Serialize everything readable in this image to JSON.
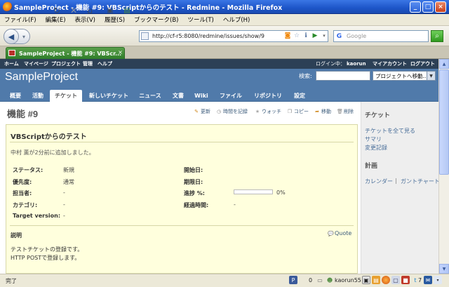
{
  "window": {
    "title": "SampleProject - 機能 #9: VBScriptからのテスト - Redmine - Mozilla Firefox"
  },
  "menubar": [
    "ファイル(F)",
    "編集(E)",
    "表示(V)",
    "履歴(S)",
    "ブックマーク(B)",
    "ツール(T)",
    "ヘルプ(H)"
  ],
  "address": {
    "url": "http://cf-r5:8080/redmine/issues/show/9"
  },
  "search": {
    "placeholder": "Google",
    "engine_icon": "G"
  },
  "tab": {
    "label": "SampleProject - 機能 #9: VBScr..."
  },
  "redmine": {
    "top_menu": [
      "ホーム",
      "マイページ",
      "プロジェクト",
      "管理",
      "ヘルプ"
    ],
    "login_prefix": "ログイン中：",
    "login_user": "kaorun",
    "account_links": [
      "マイアカウント",
      "ログアウト"
    ],
    "project_title": "SampleProject",
    "search_label": "検索:",
    "jump_select": "プロジェクトへ移動...",
    "main_tabs": [
      "概要",
      "活動",
      "チケット",
      "新しいチケット",
      "ニュース",
      "文書",
      "Wiki",
      "ファイル",
      "リポジトリ",
      "設定"
    ],
    "active_tab_index": 2
  },
  "issue": {
    "title": "機能 #9",
    "context_actions": [
      "更新",
      "時間を記録",
      "ウォッチ",
      "コピー",
      "移動",
      "削除"
    ],
    "subject": "VBScriptからのテスト",
    "author_line": "中村 薫が2分前に追加しました。",
    "attributes_left": [
      {
        "label": "ステータス:",
        "value": "新規"
      },
      {
        "label": "優先度:",
        "value": "通常"
      },
      {
        "label": "担当者:",
        "value": "-"
      },
      {
        "label": "カテゴリ:",
        "value": "-"
      },
      {
        "label": "Target version:",
        "value": "-"
      }
    ],
    "attributes_right": [
      {
        "label": "開始日:",
        "value": ""
      },
      {
        "label": "期限日:",
        "value": ""
      },
      {
        "label": "進捗 %:",
        "value": "0%"
      },
      {
        "label": "経過時間:",
        "value": "-"
      }
    ],
    "progress": 0,
    "description_label": "説明",
    "quote_label": "Quote",
    "description": [
      "テストチケットの登録です。",
      "HTTP POSTで登録します。"
    ]
  },
  "sidebar": {
    "heading_tickets": "チケット",
    "ticket_links": [
      "チケットを全て見る",
      "サマリ",
      "変更記録"
    ],
    "heading_plan": "計画",
    "plan_links": [
      "カレンダー",
      "ガントチャート"
    ],
    "plan_separator": "|"
  },
  "statusbar": {
    "text": "完了",
    "count": "0",
    "user": "kaorun55",
    "badge_count": "7"
  }
}
